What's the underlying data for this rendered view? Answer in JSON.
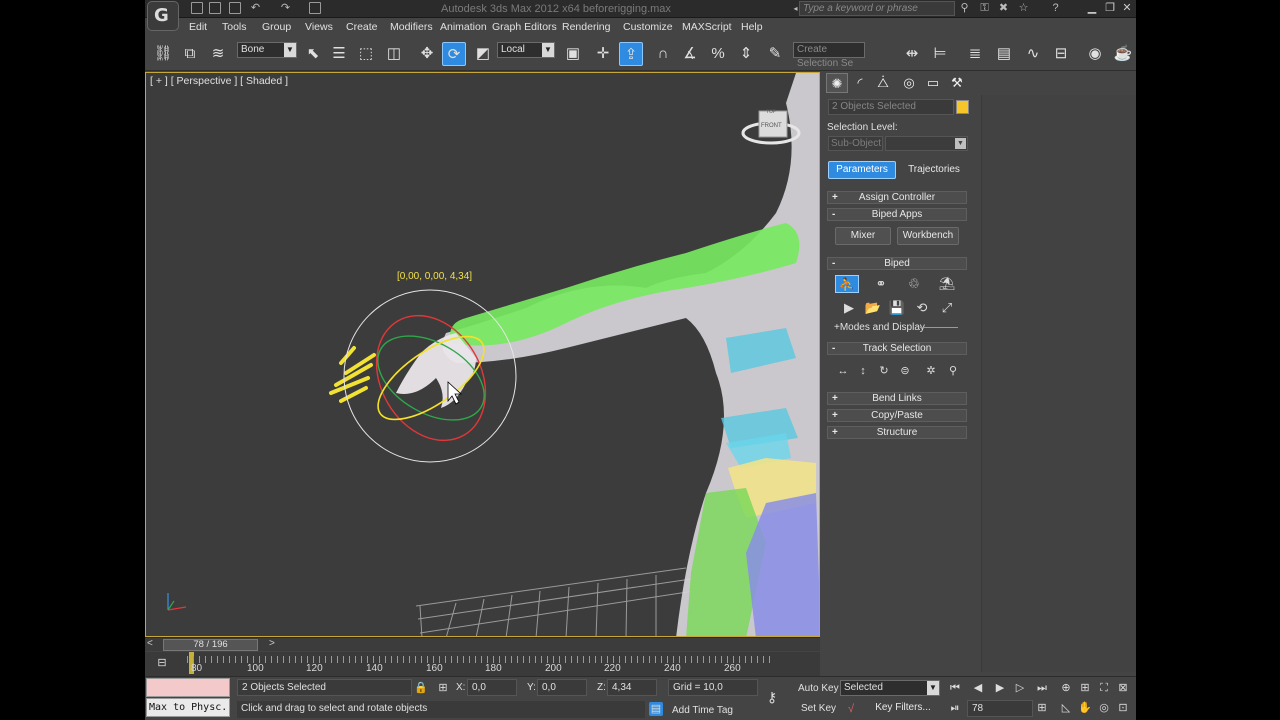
{
  "titlebar": {
    "title": "Autodesk 3ds Max  2012 x64    beforerigging.max",
    "search_placeholder": "Type a keyword or phrase",
    "app_logo_glyph": "G"
  },
  "menu": [
    "Edit",
    "Tools",
    "Group",
    "Views",
    "Create",
    "Modifiers",
    "Animation",
    "Graph Editors",
    "Rendering",
    "Customize",
    "MAXScript",
    "Help"
  ],
  "toolbar": {
    "selection_filter": "Bone",
    "ref_coord": "Local",
    "named_selection_placeholder": "Create Selection Se"
  },
  "viewport": {
    "label": "[ + ] [ Perspective ] [ Shaded ]",
    "gizmo_readout": "[0,00, 0,00, 4,34]",
    "viewcube_label": "FRONT",
    "viewcube_top_label": "TOP"
  },
  "command_panel": {
    "object_name": "2 Objects Selected",
    "selection_level_label": "Selection Level:",
    "sub_object": "Sub-Object",
    "tab_parameters": "Parameters",
    "tab_trajectories": "Trajectories",
    "rollouts": {
      "assign_controller": "Assign Controller",
      "biped_apps": "Biped Apps",
      "biped": "Biped",
      "track_selection": "Track Selection",
      "bend_links": "Bend Links",
      "copy_paste": "Copy/Paste",
      "structure": "Structure"
    },
    "mixer": "Mixer",
    "workbench": "Workbench",
    "modes_and_display": "+Modes and Display",
    "rollout_sign_open": "-",
    "rollout_sign_closed": "+"
  },
  "time": {
    "slider_label": "78 / 196",
    "prev_arrow": "<",
    "next_arrow": ">",
    "ticks": [
      "80",
      "100",
      "120",
      "140",
      "160",
      "180",
      "200",
      "220",
      "240",
      "260"
    ],
    "current_frame": "78"
  },
  "status": {
    "maxscript_label": "Max to Physc.",
    "selected_count": "2 Objects Selected",
    "prompt": "Click and drag to select and rotate objects",
    "x_label": "X:",
    "x_value": "0,0",
    "y_label": "Y:",
    "y_value": "0,0",
    "z_label": "Z:",
    "z_value": "4,34",
    "grid": "Grid = 10,0",
    "add_time_tag": "Add Time Tag",
    "auto_key": "Auto Key",
    "set_key": "Set Key",
    "key_mode": "Selected",
    "key_filters": "Key Filters..."
  },
  "colors": {
    "accent": "#2f8be0",
    "viewport_border": "#c7a63a",
    "object_color": "#f5c52a",
    "maxscript_pink": "#f3c9c9"
  }
}
